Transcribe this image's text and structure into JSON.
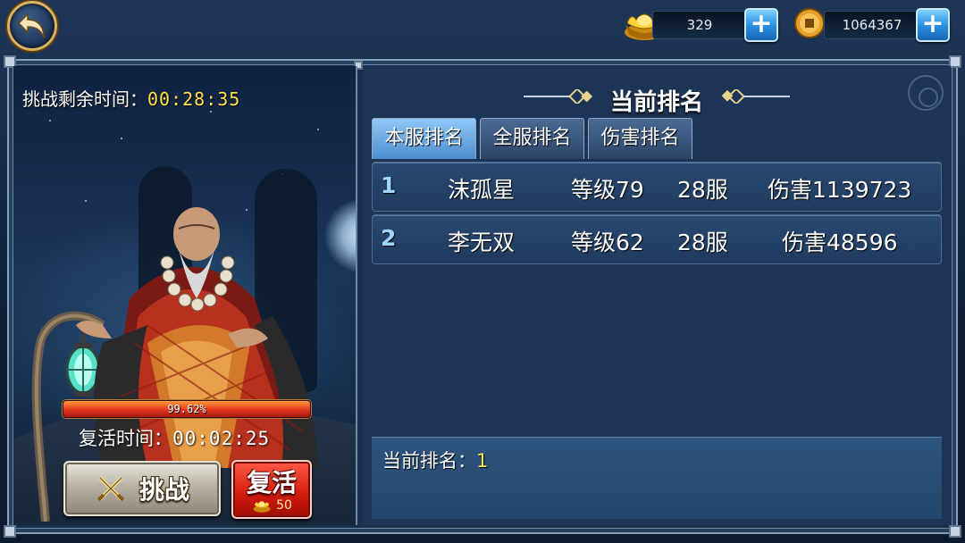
{
  "topbar": {
    "back_icon": "back-arrow-icon",
    "gold_icon": "gold-ingot-icon",
    "gold_value": "329",
    "coin_icon": "copper-coin-icon",
    "coin_value": "1064367",
    "plus_symbol": "+"
  },
  "boss_panel": {
    "time_left_label": "挑战剩余时间：",
    "time_left_value": "00:28:35",
    "hp_percent_text": "99.62%",
    "hp_fraction": 0.9962,
    "revive_time_label": "复活时间：",
    "revive_time_value": "00:02:25",
    "challenge_button": "挑战",
    "revive_button": "复活",
    "revive_cost": "50"
  },
  "ranking_panel": {
    "title": "当前排名",
    "tabs": [
      {
        "label": "本服排名",
        "active": true
      },
      {
        "label": "全服排名",
        "active": false
      },
      {
        "label": "伤害排名",
        "active": false
      }
    ],
    "rows": [
      {
        "rank": "1",
        "name": "沫孤星",
        "level": "等级79",
        "server": "28服",
        "damage": "伤害1139723"
      },
      {
        "rank": "2",
        "name": "李无双",
        "level": "等级62",
        "server": "28服",
        "damage": "伤害48596"
      }
    ],
    "current_rank_label": "当前排名：",
    "current_rank_value": "1"
  },
  "colors": {
    "highlight_yellow": "#ffe24a",
    "panel_blue": "#1c3556",
    "hp_red": "#e3341c",
    "revive_red": "#d81e10",
    "tab_active": "#4e8ed0"
  }
}
